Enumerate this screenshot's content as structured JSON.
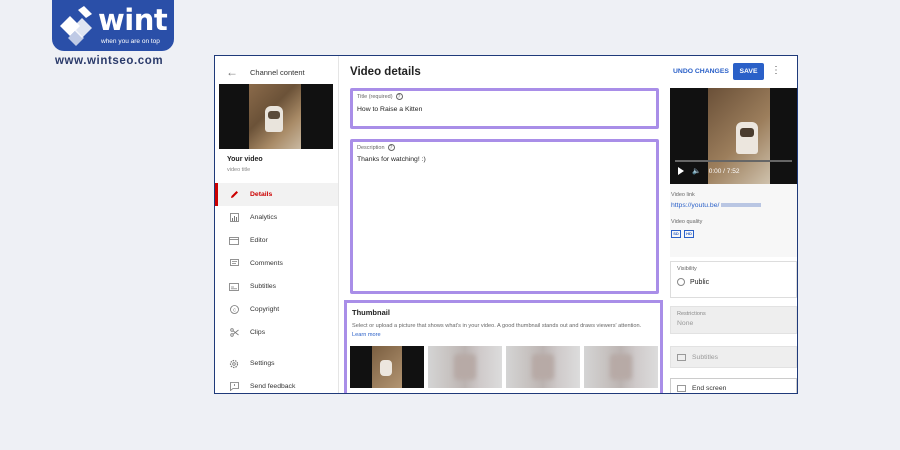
{
  "brand": {
    "name": "wint",
    "tagline": "when you are on top",
    "url": "www.wintseo.com",
    "color": "#2a4fa8"
  },
  "sidebar": {
    "header": "Channel content",
    "your_video": "Your video",
    "video_title": "video title",
    "items": [
      {
        "label": "Details",
        "icon": "pencil-icon",
        "active": true
      },
      {
        "label": "Analytics",
        "icon": "analytics-icon",
        "active": false
      },
      {
        "label": "Editor",
        "icon": "editor-icon",
        "active": false
      },
      {
        "label": "Comments",
        "icon": "comments-icon",
        "active": false
      },
      {
        "label": "Subtitles",
        "icon": "subtitles-icon",
        "active": false
      },
      {
        "label": "Copyright",
        "icon": "copyright-icon",
        "active": false
      },
      {
        "label": "Clips",
        "icon": "scissors-icon",
        "active": false
      }
    ],
    "bottom_items": [
      {
        "label": "Settings",
        "icon": "gear-icon"
      },
      {
        "label": "Send feedback",
        "icon": "feedback-icon"
      }
    ]
  },
  "main": {
    "page_title": "Video details",
    "title_field": {
      "label": "Title (required)",
      "value": "How to Raise a Kitten"
    },
    "description_field": {
      "label": "Description",
      "value": "Thanks for watching! :)"
    },
    "thumbnail": {
      "title": "Thumbnail",
      "description": "Select or upload a picture that shows what's in your video. A good thumbnail stands out and draws viewers' attention.",
      "link": "Learn more"
    }
  },
  "right": {
    "undo": "UNDO CHANGES",
    "save": "SAVE",
    "player_time": "0:00 / 7:52",
    "video_link_label": "Video link",
    "video_link": "https://youtu.be/",
    "video_quality_label": "Video quality",
    "quality_badges": [
      "SD",
      "HD"
    ],
    "visibility_label": "Visibility",
    "visibility_value": "Public",
    "restrictions_label": "Restrictions",
    "restrictions_value": "None",
    "subtitles": "Subtitles",
    "end_screen": "End screen"
  },
  "colors": {
    "accent": "#2a60c8",
    "highlight": "#a98ee8",
    "active_red": "#cc0000"
  }
}
